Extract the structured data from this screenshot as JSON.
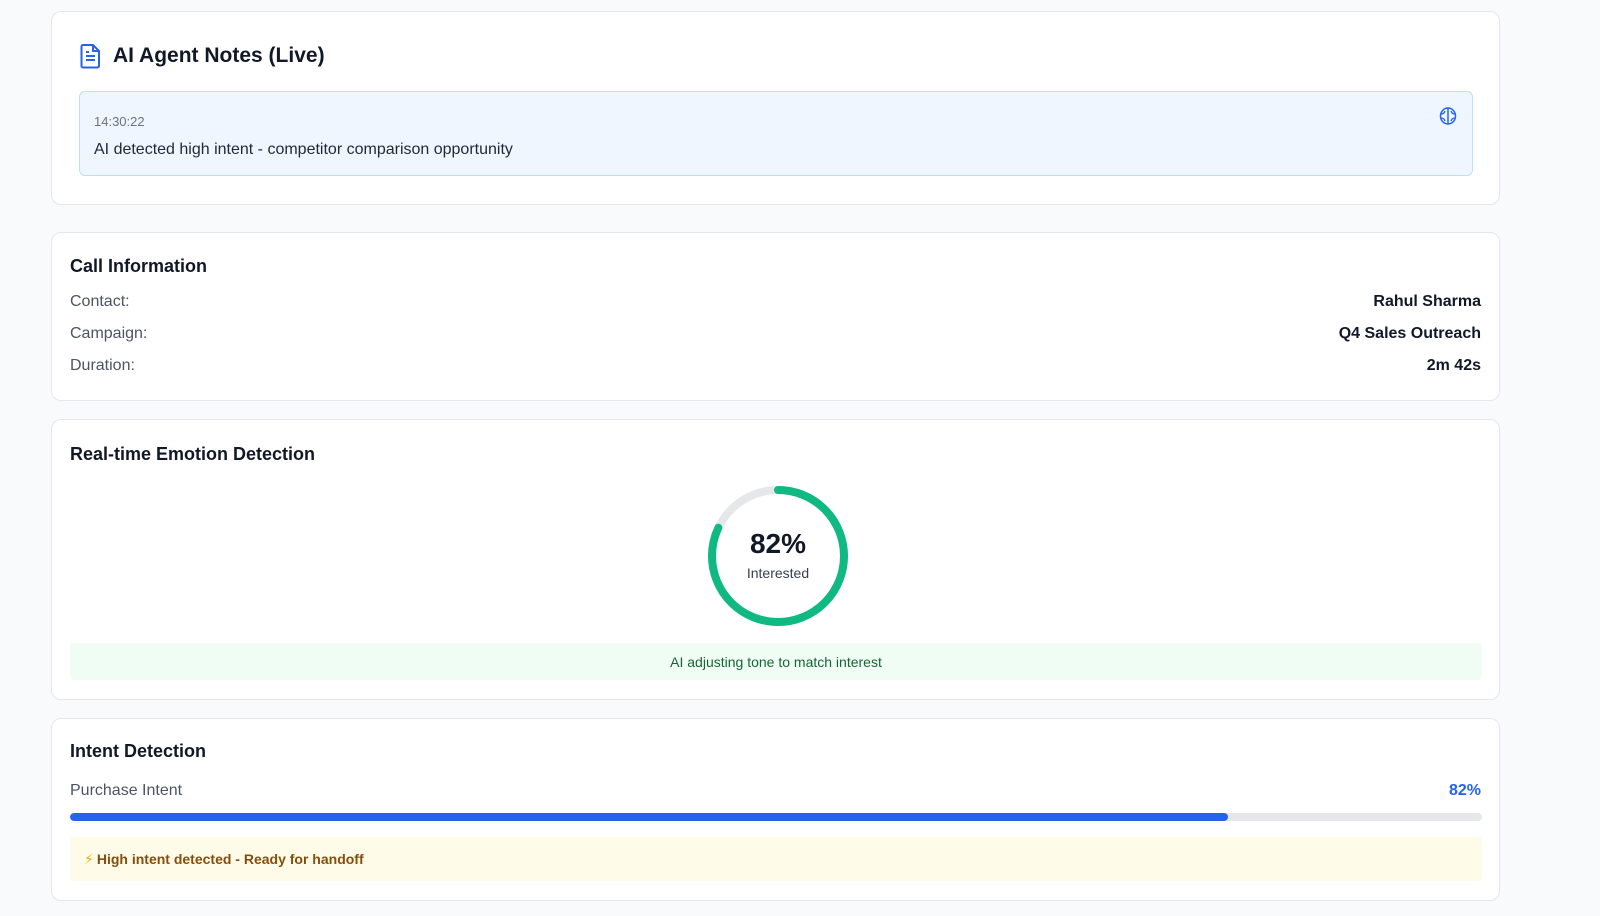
{
  "notes": {
    "title": "AI Agent Notes (Live)",
    "items": [
      {
        "time": "14:30:22",
        "text": "AI detected high intent - competitor comparison opportunity",
        "icon": "brain-icon"
      }
    ]
  },
  "call_info": {
    "title": "Call Information",
    "rows": [
      {
        "label": "Contact:",
        "value": "Rahul Sharma"
      },
      {
        "label": "Campaign:",
        "value": "Q4 Sales Outreach"
      },
      {
        "label": "Duration:",
        "value": "2m 42s"
      }
    ]
  },
  "emotion": {
    "title": "Real-time Emotion Detection",
    "percent_text": "82%",
    "percent": 82,
    "label": "Interested",
    "status": "AI adjusting tone to match interest",
    "color": "#10b981"
  },
  "intent": {
    "title": "Intent Detection",
    "label": "Purchase Intent",
    "value_text": "82%",
    "value": 82,
    "alert_icon": "⚡",
    "alert": "High intent detected - Ready for handoff",
    "color": "#2563eb"
  }
}
